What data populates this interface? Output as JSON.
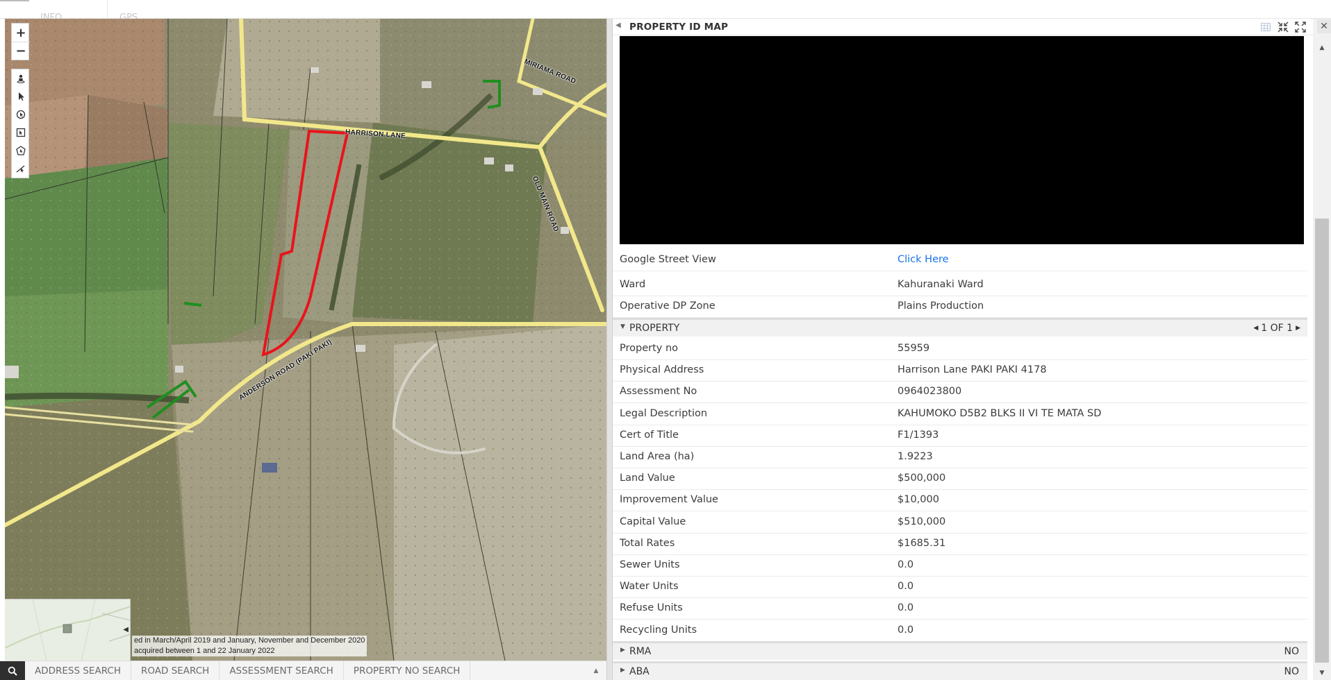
{
  "top_tabs": [
    {
      "label": "INFO"
    },
    {
      "label": "GPS"
    }
  ],
  "map": {
    "zoom_in": "+",
    "zoom_out": "−",
    "tools": [
      "street-view-icon",
      "select-pointer-icon",
      "identify-icon",
      "box-select-icon",
      "polygon-select-icon",
      "measure-icon"
    ],
    "attribution_line1": "ed in March/April 2019 and January, November and December 2020",
    "attribution_line2": "acquired between 1 and 22 January 2022",
    "roads": [
      {
        "name": "HARRISON LANE"
      },
      {
        "name": "MIRIAMA ROAD"
      },
      {
        "name": "OLD MAIN ROAD"
      },
      {
        "name": "ANDERSON ROAD (PAKI PAKI)"
      }
    ],
    "colors": {
      "selected_parcel": "#e8141b",
      "other_parcels": "#1f8f1f",
      "roads": "#f2e88b"
    }
  },
  "search_bar": {
    "tabs": [
      "ADDRESS SEARCH",
      "ROAD SEARCH",
      "ASSESSMENT SEARCH",
      "PROPERTY NO SEARCH"
    ]
  },
  "panel": {
    "title": "PROPERTY ID MAP",
    "info_rows": [
      {
        "label": "Google Street View",
        "value": "Click Here",
        "link": true
      },
      {
        "label": "Ward",
        "value": "Kahuranaki Ward"
      },
      {
        "label": "Operative DP Zone",
        "value": "Plains Production"
      }
    ],
    "property_section": {
      "title": "PROPERTY",
      "pager": "1 OF 1",
      "rows": [
        {
          "label": "Property no",
          "value": "55959"
        },
        {
          "label": "Physical Address",
          "value": "Harrison Lane PAKI PAKI 4178"
        },
        {
          "label": "Assessment No",
          "value": "0964023800"
        },
        {
          "label": "Legal Description",
          "value": "KAHUMOKO D5B2 BLKS II VI TE MATA SD"
        },
        {
          "label": "Cert of Title",
          "value": "F1/1393"
        },
        {
          "label": "Land Area (ha)",
          "value": "1.9223"
        },
        {
          "label": "Land Value",
          "value": "$500,000"
        },
        {
          "label": "Improvement Value",
          "value": "$10,000"
        },
        {
          "label": "Capital Value",
          "value": "$510,000"
        },
        {
          "label": "Total Rates",
          "value": "$1685.31"
        },
        {
          "label": "Sewer Units",
          "value": "0.0"
        },
        {
          "label": "Water Units",
          "value": "0.0"
        },
        {
          "label": "Refuse Units",
          "value": "0.0"
        },
        {
          "label": "Recycling Units",
          "value": "0.0"
        }
      ]
    },
    "collapsed_sections": [
      {
        "title": "RMA",
        "value": "NO"
      },
      {
        "title": "ABA",
        "value": "NO"
      }
    ]
  }
}
